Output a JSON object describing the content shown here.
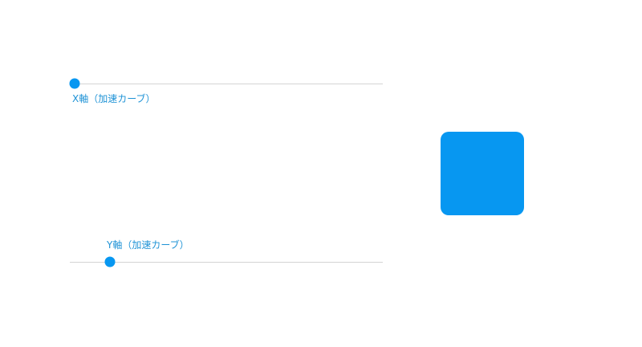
{
  "sliders": {
    "x": {
      "label": "X軸（加速カーブ）"
    },
    "y": {
      "label": "Y軸（加速カーブ）"
    }
  },
  "colors": {
    "accent": "#0797f1",
    "label": "#1f93d6",
    "track": "#d4d4d4"
  }
}
